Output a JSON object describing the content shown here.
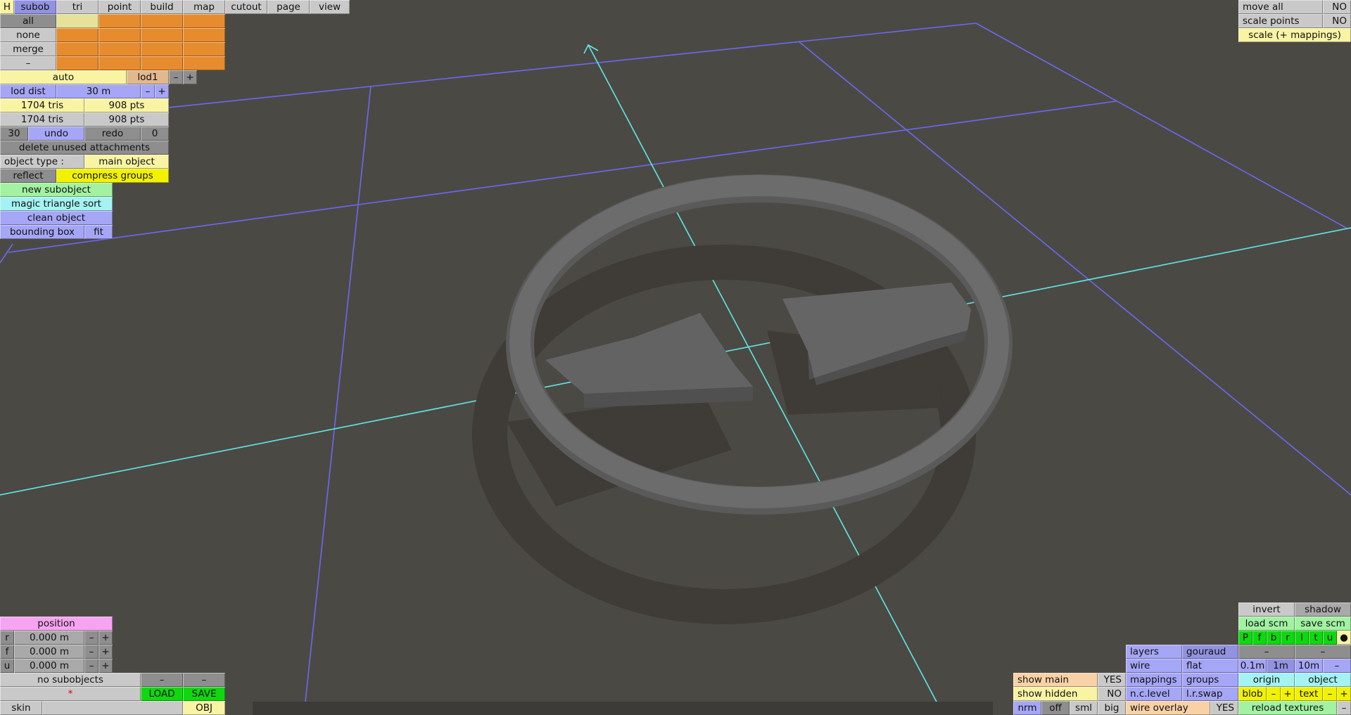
{
  "menu": {
    "h": "H",
    "subob": "subob",
    "tri": "tri",
    "point": "point",
    "build": "build",
    "map": "map",
    "cutout": "cutout",
    "page": "page",
    "view": "view"
  },
  "subob_panel": {
    "all": "all",
    "none": "none",
    "merge": "merge",
    "dash": "–"
  },
  "lod": {
    "auto": "auto",
    "level": "lod1",
    "minus": "–",
    "plus": "+",
    "dist_label": "lod dist",
    "dist_value": "30 m"
  },
  "stats": {
    "tris_selected": "1704 tris",
    "pts_selected": "908 pts",
    "tris_total": "1704 tris",
    "pts_total": "908 pts"
  },
  "history": {
    "undo_count": "30",
    "undo": "undo",
    "redo": "redo",
    "redo_count": "0"
  },
  "actions": {
    "delete_unused": "delete unused attachments",
    "object_type_label": "object type :",
    "object_type_value": "main object",
    "reflect": "reflect",
    "compress_groups": "compress groups",
    "new_subobject": "new subobject",
    "magic_sort": "magic triangle sort",
    "clean_object": "clean object",
    "bounding_box": "bounding box",
    "fit": "fit"
  },
  "position": {
    "title": "position",
    "r": {
      "label": "r",
      "value": "0.000 m"
    },
    "f": {
      "label": "f",
      "value": "0.000 m"
    },
    "u": {
      "label": "u",
      "value": "0.000 m"
    },
    "minus": "–",
    "plus": "+"
  },
  "subobjects": {
    "label": "no subobjects",
    "dash": "–",
    "name": "*",
    "load": "LOAD",
    "save": "SAVE",
    "skin": "skin",
    "skin_value": "",
    "obj": "OBJ"
  },
  "top_right": {
    "move_all": "move all",
    "move_all_value": "NO",
    "scale_points": "scale points",
    "scale_points_value": "NO",
    "scale_mappings": "scale (+ mappings)"
  },
  "bottom_right": {
    "invert": "invert",
    "shadow": "shadow",
    "load_scm": "load scm",
    "save_scm": "save scm",
    "views": [
      "P",
      "f",
      "b",
      "r",
      "l",
      "t",
      "u",
      "●"
    ],
    "layers": "layers",
    "gouraud": "gouraud",
    "dash": "–",
    "wire": "wire",
    "flat": "flat",
    "grid_01": "0.1m",
    "grid_1": "1m",
    "grid_10": "10m",
    "grid_minus": "–",
    "show_main": "show main",
    "show_main_value": "YES",
    "mappings": "mappings",
    "groups": "groups",
    "origin": "origin",
    "object": "object",
    "show_hidden": "show hidden",
    "show_hidden_value": "NO",
    "nc_level": "n.c.level",
    "lr_swap": "l.r.swap",
    "blob": "blob",
    "text": "text",
    "minus": "–",
    "plus": "+",
    "nrm": "nrm",
    "off": "off",
    "sml": "sml",
    "big": "big",
    "wire_overlay": "wire overlay",
    "wire_overlay_value": "YES",
    "reload_textures": "reload textures"
  },
  "colors": {
    "background": "#4b4944",
    "grid_line": "#6a6af0",
    "axis_line": "#60e8e8",
    "model": "#6a6a6a",
    "shadow": "#3f3b37"
  }
}
